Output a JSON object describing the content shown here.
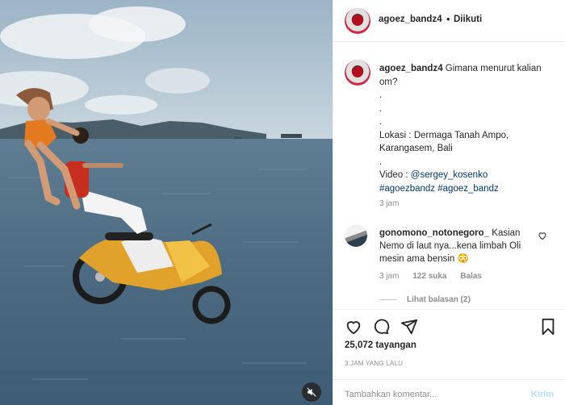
{
  "header": {
    "username": "agoez_bandz4",
    "separator": "•",
    "follow_status": "Diikuti"
  },
  "caption": {
    "username": "agoez_bandz4",
    "text": " Gimana menurut kalian om?\n.\n.\n.\nLokasi : Dermaga Tanah Ampo, Karangasem, Bali\n.\n",
    "video_prefix": "Video : ",
    "mention": "@sergey_kosenko",
    "hashtag1": "#agoezbandz",
    "hashtag2": "#agoez_bandz",
    "time": "3 jam"
  },
  "comment": {
    "username": "gonomono_notonegoro_",
    "text": " Kasian Nemo di laut nya...kena limbah Oli mesin ama bensin 😳",
    "time": "3 jam",
    "likes": "122 suka",
    "reply_label": "Balas",
    "view_replies": "Lihat balasan (2)"
  },
  "actions": {
    "icons": [
      "heart-icon",
      "comment-icon",
      "share-icon",
      "bookmark-icon"
    ]
  },
  "views": "25,072 tayangan",
  "posted_ago": "3 JAM YANG LALU",
  "add_comment": {
    "placeholder": "Tambahkan komentar...",
    "send_label": "Kirim"
  },
  "colors": {
    "link": "#00376b",
    "muted": "#8e8e8e",
    "send_disabled": "#b2dffc"
  }
}
